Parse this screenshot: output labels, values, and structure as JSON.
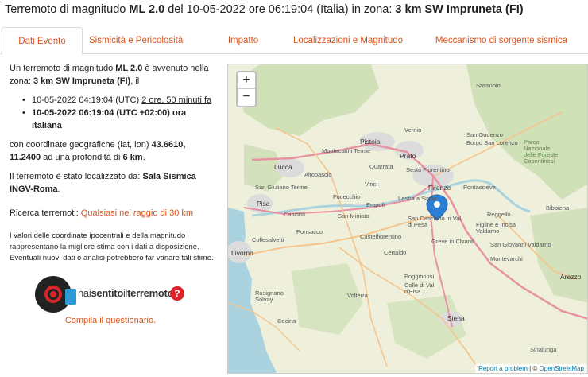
{
  "header": {
    "title_pre": "Terremoto di magnitudo ",
    "magnitude": "ML 2.0",
    "title_mid": " del 10-05-2022 ore 06:19:04 (Italia) in zona: ",
    "zone": "3 km SW Impruneta (FI)"
  },
  "tabs": [
    {
      "label": "Dati Evento"
    },
    {
      "label": "Sismicità e Pericolosità"
    },
    {
      "label": "Impatto"
    },
    {
      "label": "Localizzazioni e Magnitudo"
    },
    {
      "label": "Meccanismo di sorgente sismica"
    }
  ],
  "info": {
    "intro_1": "Un terremoto di magnitudo ",
    "magnitude": "ML 2.0",
    "intro_2": " è avvenuto nella zona: ",
    "zone": "3 km SW Impruneta (FI)",
    "intro_3": ", il",
    "utc_time": "10-05-2022 04:19:04 (UTC) ",
    "ago": "2 ore, 50 minuti fa",
    "local_time": "10-05-2022 06:19:04 (UTC +02:00) ora italiana",
    "coords_1": "con coordinate geografiche (lat, lon) ",
    "coords": "43.6610, 11.2400",
    "coords_2": " ad una profondità di ",
    "depth": "6 km",
    "coords_3": ".",
    "located_1": "Il terremoto è stato localizzato da: ",
    "located_by": "Sala Sismica INGV-Roma",
    "located_2": ".",
    "search_label": "Ricerca terremoti: ",
    "search_link": "Qualsiasi nel raggio di 30 km",
    "disclaimer": "I valori delle coordinate ipocentrali e della magnitudo rappresentano la migliore stima con i dati a disposizione. Eventuali nuovi dati o analisi potrebbero far variare tali stime."
  },
  "logo": {
    "part1": "hai",
    "part2": "sentito",
    "part3": "il",
    "part4": "terremoto",
    "help": "?"
  },
  "questionnaire_link": "Compila il questionario.",
  "map": {
    "zoom_in": "+",
    "zoom_out": "−",
    "attribution_link": "Report a problem",
    "attribution_sep": " | © ",
    "attribution_osm": "OpenStreetMap",
    "places": [
      "Pistoia",
      "Prato",
      "Montecatini Terme",
      "Lucca",
      "Altopascio",
      "Quarrata",
      "Sesto Fiorentino",
      "Firenze",
      "Pontassieve",
      "Vernio",
      "San Godenzo",
      "Borgo San Lorenzo",
      "San Giuliano Terme",
      "Pisa",
      "Cascina",
      "Fucecchio",
      "Vinci",
      "Empoli",
      "Lastra a Signa",
      "San Miniato",
      "San Casciano in Val di Pesa",
      "Reggello",
      "Figline e Incisa Valdarno",
      "Greve in Chianti",
      "San Giovanni Valdarno",
      "Montevarchi",
      "Castelfiorentino",
      "Certaldo",
      "Poggibonsi",
      "Colle di Val d'Elsa",
      "Livorno",
      "Collesalvetti",
      "Ponsacco",
      "Rosignano Solvay",
      "Volterra",
      "Siena",
      "Cecina",
      "Arezzo",
      "Bibbiena",
      "Sinalunga",
      "Sassuolo",
      "Parco Nazionale delle Foreste Casentinesi"
    ],
    "colors": {
      "water": "#aad3df",
      "land": "#eef0dc",
      "forest": "#c8dcae",
      "urban": "#dcdcdc",
      "road": "#f6c48b",
      "motorway": "#e892a2",
      "marker": "#2a7fd4"
    }
  }
}
